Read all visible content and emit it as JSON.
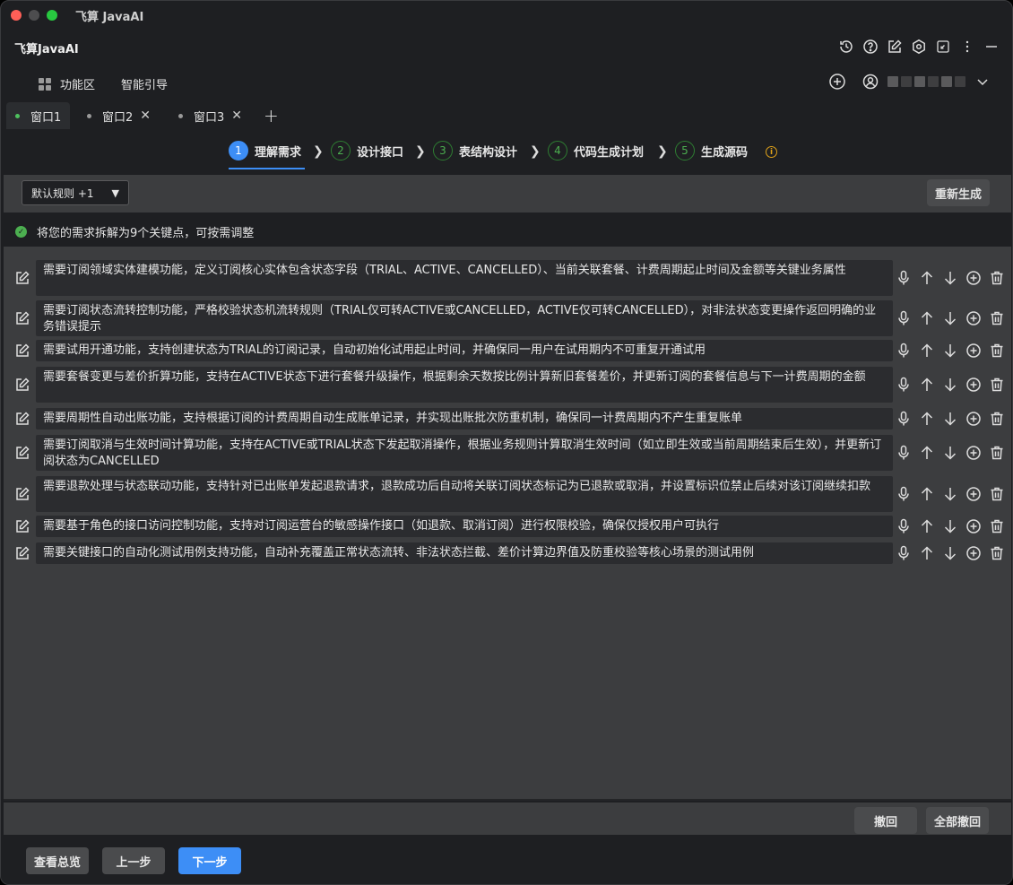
{
  "window": {
    "title": "飞算 JavaAI"
  },
  "app": {
    "name": "飞算JavaAI"
  },
  "nav": {
    "items": [
      {
        "label": "功能区"
      },
      {
        "label": "智能引导"
      }
    ]
  },
  "tabs": [
    {
      "label": "窗口1",
      "active": true
    },
    {
      "label": "窗口2",
      "active": false
    },
    {
      "label": "窗口3",
      "active": false
    }
  ],
  "steps": [
    {
      "num": "1",
      "label": "理解需求",
      "active": true
    },
    {
      "num": "2",
      "label": "设计接口",
      "active": false
    },
    {
      "num": "3",
      "label": "表结构设计",
      "active": false
    },
    {
      "num": "4",
      "label": "代码生成计划",
      "active": false
    },
    {
      "num": "5",
      "label": "生成源码",
      "active": false
    }
  ],
  "toolbar": {
    "rule_select": "默认规则 +1",
    "regenerate": "重新生成"
  },
  "status": {
    "text": "将您的需求拆解为9个关键点，可按需调整"
  },
  "requirements": [
    "需要订阅领域实体建模功能，定义订阅核心实体包含状态字段（TRIAL、ACTIVE、CANCELLED）、当前关联套餐、计费周期起止时间及金额等关键业务属性",
    "需要订阅状态流转控制功能，严格校验状态机流转规则（TRIAL仅可转ACTIVE或CANCELLED，ACTIVE仅可转CANCELLED），对非法状态变更操作返回明确的业务错误提示",
    "需要试用开通功能，支持创建状态为TRIAL的订阅记录，自动初始化试用起止时间，并确保同一用户在试用期内不可重复开通试用",
    "需要套餐变更与差价折算功能，支持在ACTIVE状态下进行套餐升级操作，根据剩余天数按比例计算新旧套餐差价，并更新订阅的套餐信息与下一计费周期的金额",
    "需要周期性自动出账功能，支持根据订阅的计费周期自动生成账单记录，并实现出账批次防重机制，确保同一计费周期内不产生重复账单",
    "需要订阅取消与生效时间计算功能，支持在ACTIVE或TRIAL状态下发起取消操作，根据业务规则计算取消生效时间（如立即生效或当前周期结束后生效），并更新订阅状态为CANCELLED",
    "需要退款处理与状态联动功能，支持针对已出账单发起退款请求，退款成功后自动将关联订阅状态标记为已退款或取消，并设置标识位禁止后续对该订阅继续扣款",
    "需要基于角色的接口访问控制功能，支持对订阅运营台的敏感操作接口（如退款、取消订阅）进行权限校验，确保仅授权用户可执行",
    "需要关键接口的自动化测试用例支持功能，自动补充覆盖正常状态流转、非法状态拦截、差价计算边界值及防重校验等核心场景的测试用例"
  ],
  "actions": {
    "undo": "撤回",
    "undo_all": "全部撤回"
  },
  "bottom": {
    "overview": "查看总览",
    "prev": "上一步",
    "next": "下一步"
  },
  "colors": {
    "accent": "#3d8ef6",
    "success": "#4caf50",
    "warning": "#e0a21a"
  },
  "icons": [
    "history-icon",
    "help-icon",
    "edit-icon",
    "settings-icon",
    "collapse-icon",
    "more-icon",
    "minimize-icon",
    "grid-icon",
    "add-circle-icon",
    "user-icon",
    "chevron-down-icon",
    "mic-icon",
    "arrow-up-icon",
    "arrow-down-icon",
    "trash-icon"
  ]
}
